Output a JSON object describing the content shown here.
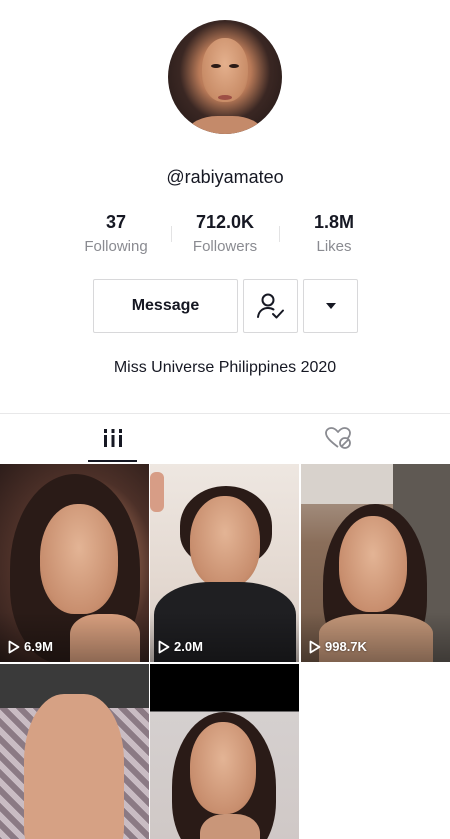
{
  "profile": {
    "username": "@rabiyamateo",
    "bio": "Miss Universe Philippines 2020"
  },
  "stats": {
    "following": {
      "value": "37",
      "label": "Following"
    },
    "followers": {
      "value": "712.0K",
      "label": "Followers"
    },
    "likes": {
      "value": "1.8M",
      "label": "Likes"
    }
  },
  "actions": {
    "message_label": "Message",
    "follow_icon": "user-check-icon",
    "more_icon": "caret-down-icon"
  },
  "tabs": {
    "videos_icon": "videos-grid-icon",
    "liked_icon": "liked-hidden-icon"
  },
  "videos": [
    {
      "views": "6.9M"
    },
    {
      "views": "2.0M"
    },
    {
      "views": "998.7K"
    },
    {
      "views": ""
    },
    {
      "views": ""
    }
  ],
  "colors": {
    "text_primary": "#161823",
    "text_secondary": "#8a8b91",
    "border": "#d8d8da"
  }
}
